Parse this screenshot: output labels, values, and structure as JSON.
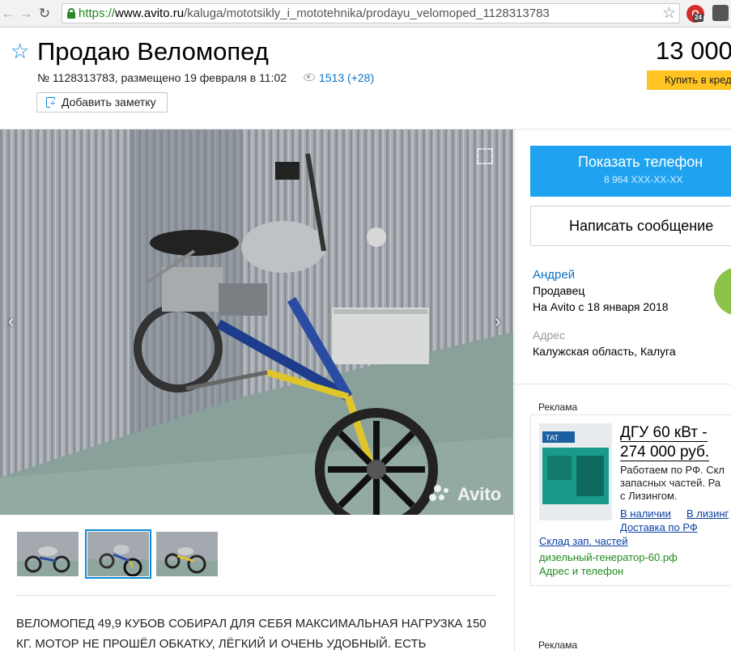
{
  "browser": {
    "url_scheme": "https://",
    "url_host": "www.avito.ru",
    "url_path": "/kaluga/mototsikly_i_mototehnika/prodayu_velomoped_1128313783",
    "back_glyph": "←",
    "forward_glyph": "→",
    "reload_glyph": "↻",
    "bookmark_glyph": "☆",
    "ext_badge": "24",
    "ext_letter": "Q"
  },
  "listing": {
    "title": "Продаю Веломопед",
    "price": "13 000",
    "credit_label": "Купить в кредит",
    "meta": "№ 1128313783, размещено 19 февраля в 11:02",
    "views": "1513 (+28)",
    "add_note_label": "Добавить заметку",
    "favorite_glyph": "☆"
  },
  "gallery": {
    "prev_glyph": "‹",
    "next_glyph": "›",
    "watermark": "Avito",
    "thumbnails": 3,
    "active_thumbnail": 2
  },
  "description": "ВЕЛОМОПЕД 49,9 КУБОВ СОБИРАЛ ДЛЯ СЕБЯ МАКСИМАЛЬНАЯ НАГРУЗКА 150 КГ. МОТОР НЕ ПРОШЁЛ ОБКАТКУ, ЛЁГКИЙ И ОЧЕНЬ УДОБНЫЙ. ЕСТЬ",
  "contact": {
    "show_phone_label": "Показать телефон",
    "phone_masked": "8 964 XXX-XX-XX",
    "write_message_label": "Написать сообщение",
    "seller_name": "Андрей",
    "seller_role": "Продавец",
    "seller_since": "На Avito с 18 января 2018",
    "address_label": "Адрес",
    "address_value": "Калужская область, Калуга"
  },
  "ads": {
    "label": "Реклама",
    "title_line1": "ДГУ 60 кВт -",
    "title_line2": "274 000 руб.",
    "text_line1": "Работаем по РФ. Скл",
    "text_line2": "запасных частей. Ра",
    "text_line3": "с Лизингом.",
    "link_in_stock": "В наличии",
    "link_leasing": "В лизинг",
    "link_delivery": "Доставка по РФ",
    "link_parts": "Склад зап. частей",
    "domain": "дизельный-генератор-60.рф",
    "contact": "Адрес и телефон",
    "label2": "Реклама"
  },
  "colors": {
    "accent_blue": "#1fa3f0",
    "link_blue": "#0a72c9",
    "credit_yellow": "#ffc322",
    "avatar_green": "#8bc34a"
  }
}
